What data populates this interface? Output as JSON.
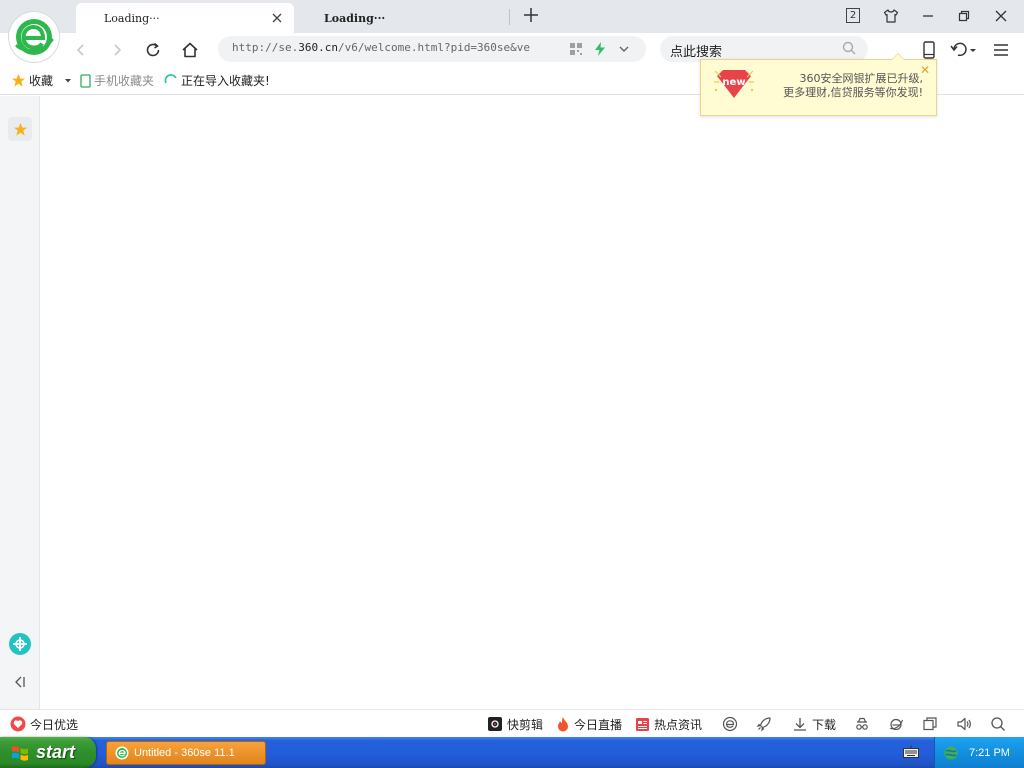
{
  "browser": {
    "tabs": [
      {
        "title": "Loading···"
      },
      {
        "title": "Loading···"
      }
    ],
    "tab_count": "2",
    "address": {
      "prefix": "http://se.",
      "domain": "360.cn",
      "suffix": "/v6/welcome.html?pid=360se&ve"
    },
    "search": {
      "placeholder": "点此搜索"
    }
  },
  "bookmarks": {
    "favorites_label": "收藏",
    "mobile_label": "手机收藏夹",
    "importing_label": "正在导入收藏夹!"
  },
  "popup": {
    "badge_text": "new",
    "line1": "360安全网银扩展已升级,",
    "line2": "更多理财,信贷服务等你发现!"
  },
  "statusbar": {
    "left_label": "今日优选",
    "items": [
      {
        "label": "快剪辑"
      },
      {
        "label": "今日直播"
      },
      {
        "label": "热点资讯"
      },
      {
        "label": "下载"
      }
    ]
  },
  "taskbar": {
    "start_label": "start",
    "window_label": "Untitled - 360se 11.1",
    "clock": "7:21 PM"
  },
  "colors": {
    "brand_green": "#2db84d",
    "accent_blue": "#245edb",
    "start_green": "#3d9c38",
    "popup_bg": "#fffbd2",
    "badge_red": "#e8424b"
  }
}
